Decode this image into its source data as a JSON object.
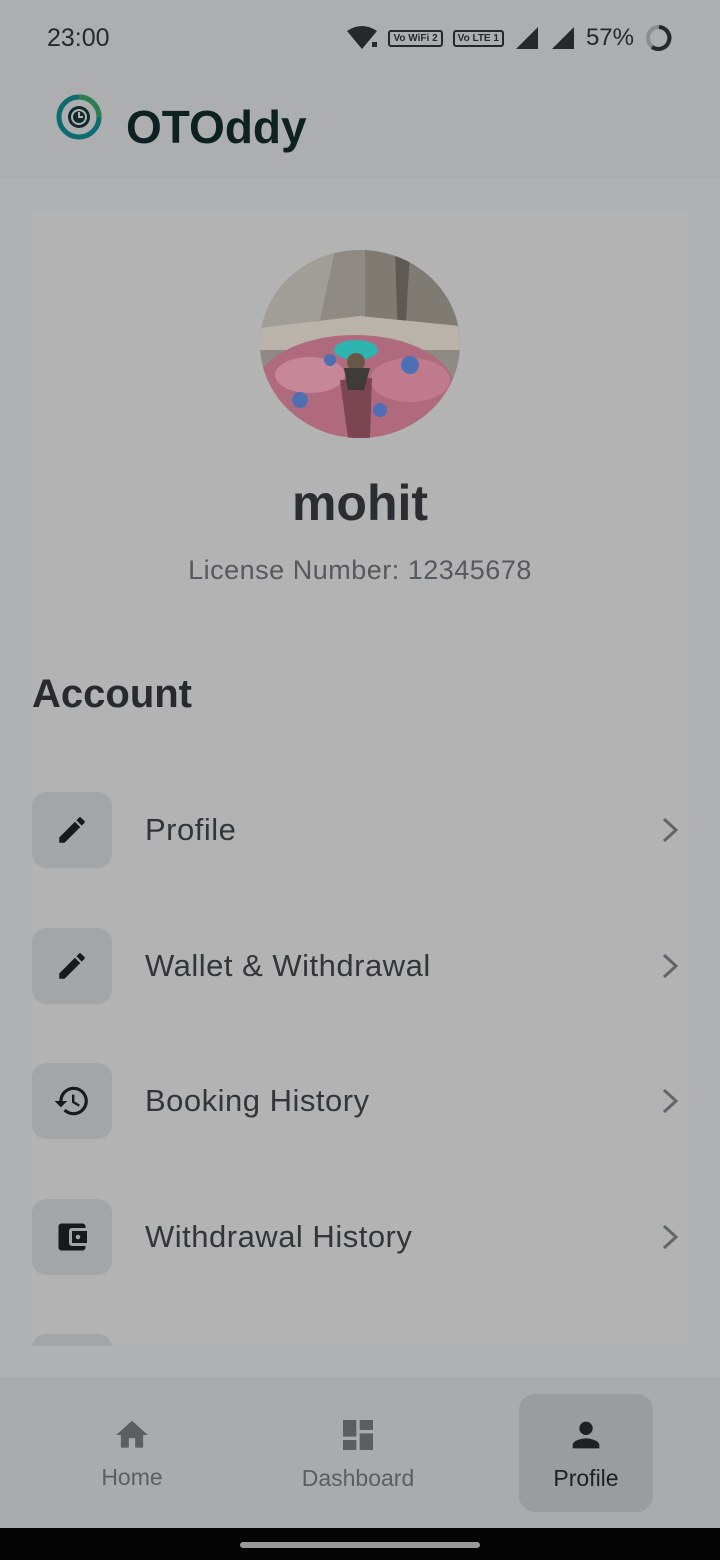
{
  "status_bar": {
    "time": "23:00",
    "wifi_badge": "Vo WiFi 2",
    "lte_badge": "Vo LTE 1",
    "battery": "57%"
  },
  "app": {
    "title": "OTOddy",
    "logo_icon": "speedometer-logo-icon"
  },
  "profile": {
    "name": "mohit",
    "license": "License Number: 12345678"
  },
  "account": {
    "section_title": "Account",
    "items": [
      {
        "label": "Profile",
        "icon": "pencil-icon"
      },
      {
        "label": "Wallet & Withdrawal",
        "icon": "pencil-icon"
      },
      {
        "label": "Booking History",
        "icon": "history-icon"
      },
      {
        "label": "Withdrawal History",
        "icon": "wallet-icon"
      }
    ]
  },
  "bottom_nav": {
    "items": [
      {
        "label": "Home",
        "icon": "home-icon",
        "active": false
      },
      {
        "label": "Dashboard",
        "icon": "dashboard-icon",
        "active": false
      },
      {
        "label": "Profile",
        "icon": "person-icon",
        "active": true
      }
    ]
  },
  "colors": {
    "accent_dark": "#0d2022",
    "logo_teal": "#0e6b70",
    "logo_green": "#2f7d4d"
  }
}
